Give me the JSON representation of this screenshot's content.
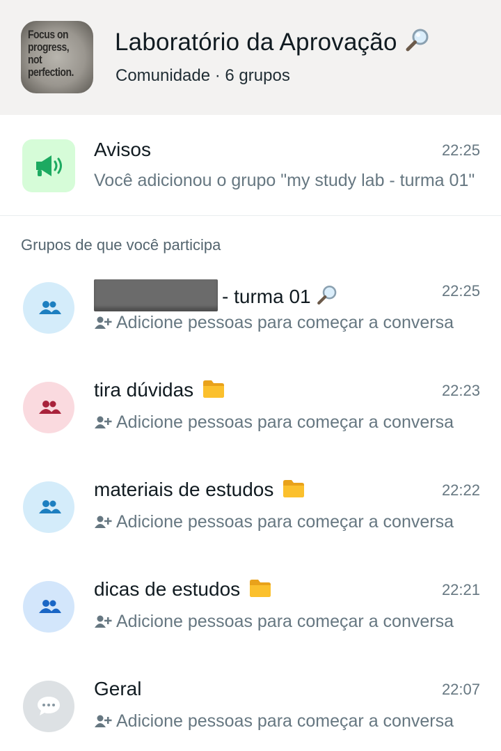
{
  "community": {
    "avatar_text": [
      "Focus on",
      "progress,",
      "not",
      "perfection."
    ],
    "title": "Laboratório da Aprovação",
    "subtitle": "Comunidade · 6 grupos",
    "title_icon": "magnifier-icon"
  },
  "announcements": {
    "title": "Avisos",
    "time": "22:25",
    "preview": "Você adicionou o grupo \"my study lab - turma 01\"",
    "icon": "megaphone-icon",
    "accent": "#1daa61"
  },
  "section_label": "Grupos de que você participa",
  "groups": [
    {
      "title": "- turma 01",
      "time": "22:25",
      "preview": "Adicione pessoas para começar a conversa",
      "avatar_bg": "#d4ecfa",
      "icon_color": "#1d7fc0",
      "redacted": true,
      "title_icon": "magnifier-icon"
    },
    {
      "title": "tira dúvidas",
      "time": "22:23",
      "preview": "Adicione pessoas para começar a conversa",
      "avatar_bg": "#fadadf",
      "icon_color": "#a8223b",
      "title_icon": "folder-icon"
    },
    {
      "title": "materiais de estudos",
      "time": "22:22",
      "preview": "Adicione pessoas para começar a conversa",
      "avatar_bg": "#d4ecfa",
      "icon_color": "#1d7fc0",
      "title_icon": "folder-icon"
    },
    {
      "title": "dicas de estudos",
      "time": "22:21",
      "preview": "Adicione pessoas para começar a conversa",
      "avatar_bg": "#d3e6fb",
      "icon_color": "#1a66c5",
      "title_icon": "folder-icon"
    },
    {
      "title": "Geral",
      "time": "22:07",
      "preview": "Adicione pessoas para começar a conversa",
      "avatar_bg": "#dde1e4",
      "icon_color": "#ffffff",
      "avatar_icon": "speech-bubble-icon"
    }
  ]
}
